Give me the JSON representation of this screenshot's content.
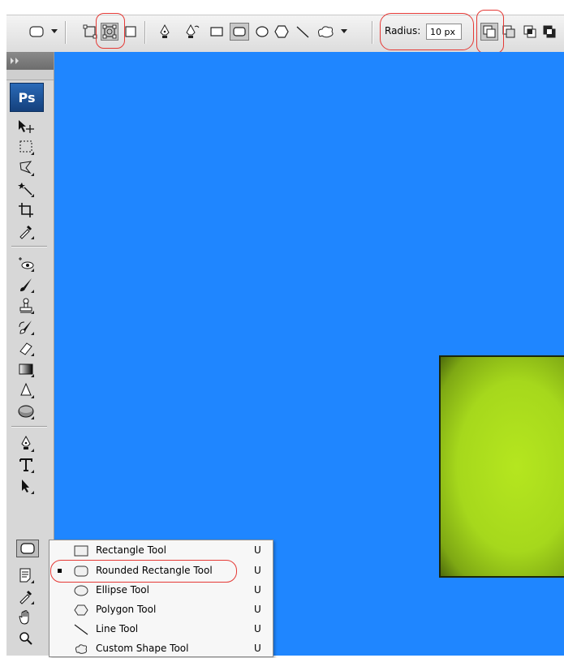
{
  "app": {
    "logo": "Ps"
  },
  "options_bar": {
    "tool_preset_icon": "rounded-rect-icon",
    "modes": [
      "shape-layers-icon",
      "paths-icon",
      "fill-pixels-icon"
    ],
    "selected_mode": 1,
    "tools": [
      "pen-icon",
      "freeform-pen-icon",
      "rectangle-icon",
      "rounded-rectangle-icon",
      "ellipse-icon",
      "polygon-icon",
      "line-icon",
      "custom-shape-icon"
    ],
    "selected_tool": 3,
    "radius_label": "Radius:",
    "radius_value": "10 px",
    "path_ops": [
      "add-icon",
      "subtract-icon",
      "intersect-icon",
      "exclude-icon"
    ],
    "selected_op": 0
  },
  "canvas": {
    "background": "#1f86ff",
    "shape_color": "#a6d81c"
  },
  "flyout": {
    "items": [
      {
        "label": "Rectangle Tool",
        "key": "U",
        "icon": "rectangle-icon",
        "selected": false
      },
      {
        "label": "Rounded Rectangle Tool",
        "key": "U",
        "icon": "rounded-rectangle-icon",
        "selected": true
      },
      {
        "label": "Ellipse Tool",
        "key": "U",
        "icon": "ellipse-icon",
        "selected": false
      },
      {
        "label": "Polygon Tool",
        "key": "U",
        "icon": "polygon-icon",
        "selected": false
      },
      {
        "label": "Line Tool",
        "key": "U",
        "icon": "line-icon",
        "selected": false
      },
      {
        "label": "Custom Shape Tool",
        "key": "U",
        "icon": "custom-shape-icon",
        "selected": false
      }
    ]
  },
  "highlight_color": "#e53935"
}
